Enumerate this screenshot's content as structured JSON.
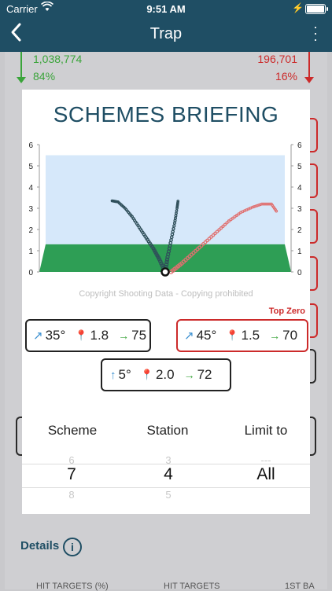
{
  "status_bar": {
    "carrier": "Carrier",
    "time": "9:51 AM"
  },
  "nav": {
    "title": "Trap",
    "back_icon": "chevron-left-icon",
    "more_icon": "more-vertical-icon"
  },
  "background": {
    "green_count": "1,038,774",
    "green_pct": "84%",
    "red_count": "196,701",
    "red_pct": "16%",
    "details_label": "Details",
    "col1": "HIT TARGETS (%)",
    "col2": "HIT TARGETS",
    "col3": "1ST BA"
  },
  "modal": {
    "title": "SCHEMES BRIEFING",
    "copyright": "Copyright Shooting Data - Copying prohibited",
    "top_zero_label": "Top Zero",
    "schemes": [
      {
        "angle": "35°",
        "height": "1.8",
        "distance": "75",
        "highlight": false
      },
      {
        "angle": "45°",
        "height": "1.5",
        "distance": "70",
        "highlight": true
      },
      {
        "angle": "5°",
        "height": "2.0",
        "distance": "72",
        "highlight": false
      }
    ],
    "picker": {
      "headers": [
        "Scheme",
        "Station",
        "Limit to"
      ],
      "above": [
        "6",
        "3",
        "---"
      ],
      "selected": [
        "7",
        "4",
        "All"
      ],
      "below": [
        "8",
        "5",
        ""
      ]
    }
  },
  "chart_data": {
    "type": "scatter",
    "y_ticks": [
      "0",
      "1",
      "2",
      "3",
      "4",
      "5",
      "6"
    ],
    "ylim": [
      0,
      6
    ],
    "colors": {
      "left": "#2f4f5a",
      "right": "#e07070",
      "ground": "#2e9e55",
      "sky": "#d6e8fa"
    },
    "series": [
      {
        "color_key": "left",
        "points": [
          [
            -0.45,
            3.35
          ],
          [
            -0.4,
            3.3
          ],
          [
            -0.34,
            3.0
          ],
          [
            -0.28,
            2.6
          ],
          [
            -0.22,
            2.1
          ],
          [
            -0.16,
            1.6
          ],
          [
            -0.1,
            1.1
          ],
          [
            -0.05,
            0.6
          ],
          [
            0.0,
            0.0
          ]
        ]
      },
      {
        "color_key": "left",
        "points": [
          [
            0.0,
            0.0
          ],
          [
            0.02,
            0.7
          ],
          [
            0.05,
            1.5
          ],
          [
            0.08,
            2.3
          ],
          [
            0.1,
            3.0
          ],
          [
            0.11,
            3.4
          ]
        ]
      },
      {
        "color_key": "right",
        "points": [
          [
            0.05,
            0.0
          ],
          [
            0.14,
            0.4
          ],
          [
            0.24,
            0.9
          ],
          [
            0.34,
            1.4
          ],
          [
            0.44,
            1.9
          ],
          [
            0.54,
            2.4
          ],
          [
            0.64,
            2.8
          ],
          [
            0.74,
            3.05
          ],
          [
            0.82,
            3.2
          ],
          [
            0.9,
            3.2
          ],
          [
            0.95,
            2.8
          ]
        ]
      }
    ]
  }
}
